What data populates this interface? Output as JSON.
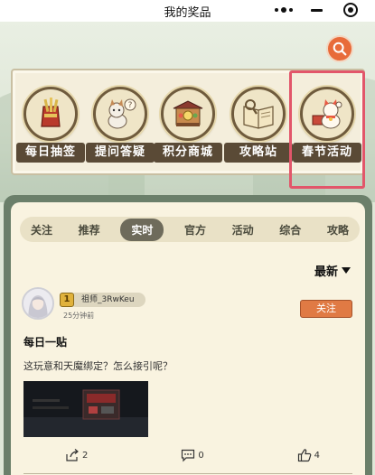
{
  "titlebar": {
    "title": "我的奖品"
  },
  "menu": [
    {
      "label": "每日抽签",
      "icon": "fortune-stick-icon"
    },
    {
      "label": "提问答疑",
      "icon": "cat-question-icon"
    },
    {
      "label": "积分商城",
      "icon": "shop-stall-icon"
    },
    {
      "label": "攻略站",
      "icon": "guide-book-icon"
    },
    {
      "label": "春节活动",
      "icon": "lucky-cat-icon"
    }
  ],
  "tabs": [
    {
      "label": "关注"
    },
    {
      "label": "推荐"
    },
    {
      "label": "实时",
      "active": true
    },
    {
      "label": "官方"
    },
    {
      "label": "活动"
    },
    {
      "label": "综合"
    },
    {
      "label": "攻略"
    }
  ],
  "sort": {
    "label": "最新"
  },
  "post": {
    "level": "1",
    "username": "祖师_3RwKeu",
    "time": "25分钟前",
    "follow_label": "关注",
    "title": "每日一贴",
    "body": "这玩意和天魔绑定？怎么接引呢？",
    "share_count": "2",
    "comment_count": "0",
    "like_count": "4"
  },
  "colors": {
    "accent_orange": "#e07a44",
    "highlight_red": "#e2566a",
    "panel_green": "#6b7f6a"
  }
}
